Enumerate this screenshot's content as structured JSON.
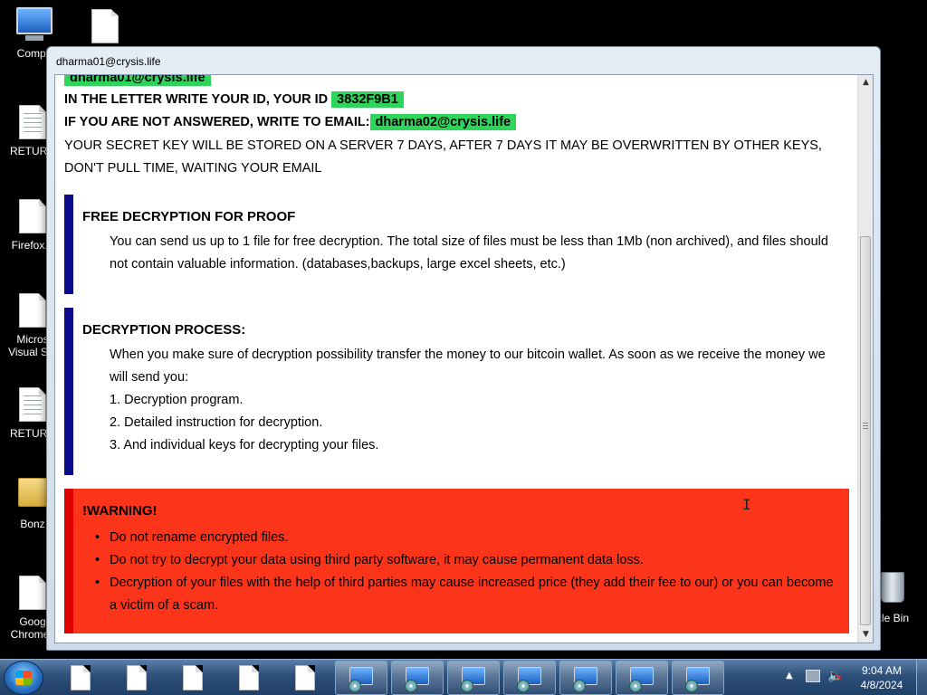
{
  "desktop": {
    "icons": [
      {
        "label": "Compu",
        "kind": "computer"
      },
      {
        "label": "",
        "kind": "doc"
      },
      {
        "label": "RETURN",
        "kind": "doc"
      },
      {
        "label": "Firefox.lr",
        "kind": "doc"
      },
      {
        "label": "Micros\nVisual Stu",
        "kind": "doc"
      },
      {
        "label": "RETURN",
        "kind": "doc"
      },
      {
        "label": "Bonz",
        "kind": "folder"
      },
      {
        "label": "Goog\nChrome.l",
        "kind": "doc"
      },
      {
        "label": "cle Bin",
        "kind": "recycle-bin"
      }
    ]
  },
  "window": {
    "title": "dharma01@crysis.life",
    "top_email": "dharma01@crysis.life",
    "id_line_prefix": "IN THE LETTER WRITE YOUR ID, YOUR ID ",
    "id_value": "3832F9B1",
    "email_line_prefix": "IF YOU ARE NOT ANSWERED, WRITE TO EMAIL:",
    "email2": "dharma02@crysis.life",
    "key_line1": "YOUR SECRET KEY WILL BE STORED ON A SERVER 7 DAYS, AFTER 7 DAYS IT MAY BE OVERWRITTEN BY OTHER KEYS,",
    "key_line2": "DON'T PULL TIME, WAITING YOUR EMAIL",
    "proof": {
      "heading": "FREE DECRYPTION FOR PROOF",
      "text": "You can send us up to 1 file for free decryption. The total size of files must be less than 1Mb (non archived), and files should not contain valuable information. (databases,backups, large excel sheets, etc.)"
    },
    "process": {
      "heading": "DECRYPTION PROCESS:",
      "text": "When you make sure of decryption possibility transfer the money to our bitcoin wallet. As soon as we receive the money we will send you:",
      "items": [
        "1. Decryption program.",
        "2. Detailed instruction for decryption.",
        "3. And individual keys for decrypting your files."
      ]
    },
    "warning": {
      "heading": "!WARNING!",
      "items": [
        "Do not rename encrypted files.",
        "Do not try to decrypt your data using third party software, it may cause permanent data loss.",
        "Decryption of your files with the help of third parties may cause increased price (they add their fee to our) or you can become a victim of a scam."
      ]
    }
  },
  "taskbar": {
    "clock_time": "9:04 AM",
    "clock_date": "4/8/2024",
    "pinned_docs": 5,
    "running_apps": 7
  },
  "colors": {
    "highlight": "#2fd55a",
    "warning_bg": "#fc3419",
    "section_bar": "#0a0a8a"
  }
}
